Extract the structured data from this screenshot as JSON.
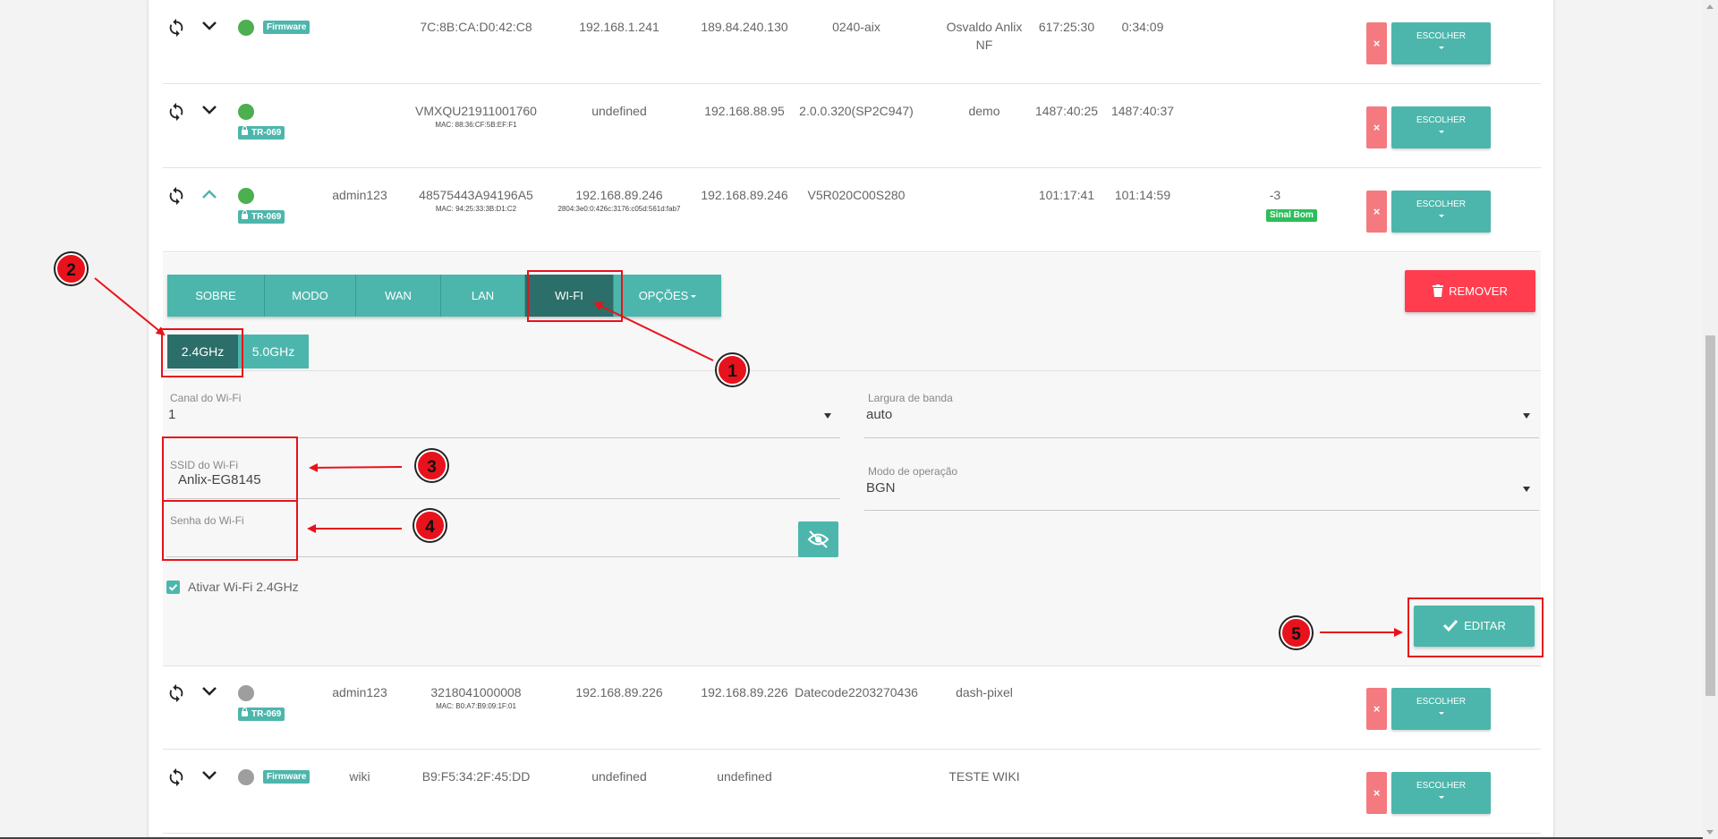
{
  "colors": {
    "teal": "#4db6ac",
    "teal_dark": "#2c6e69",
    "danger": "#ff3d4f",
    "delete_light": "#f47a7f",
    "status_online": "#4caf50",
    "status_offline": "#9e9e9e",
    "signal_good": "#2dbe5a",
    "annotation": "#e8121c"
  },
  "icons": {
    "sync": "sync-icon",
    "expand": "chevron-down-icon",
    "collapse": "chevron-up-icon",
    "lock": "lock-icon",
    "trash": "trash-icon",
    "eye_off": "eye-off-icon",
    "check": "check-icon"
  },
  "rows_top": [
    {
      "status": "online",
      "badge": "Firmware",
      "user": "",
      "serial": "7C:8B:CA:D0:42:C8",
      "mac": "",
      "ip_local": "192.168.1.241",
      "ip_public": "189.84.240.130",
      "version": "0240-aix",
      "name": "Osvaldo Anlix NF",
      "uptime": "617:25:30",
      "conn_time": "0:34:09",
      "signal": "",
      "signal_label": "",
      "delete_label": "×",
      "choose_label": "ESCOLHER"
    },
    {
      "status": "online",
      "badge": "TR-069",
      "user": "",
      "serial": "VMXQU21911001760",
      "mac": "MAC: 88:36:CF:5B:EF:F1",
      "ip_local": "undefined",
      "ip_public": "192.168.88.95",
      "version": "2.0.0.320(SP2C947)",
      "name": "demo",
      "uptime": "1487:40:25",
      "conn_time": "1487:40:37",
      "signal": "",
      "signal_label": "",
      "delete_label": "×",
      "choose_label": "ESCOLHER"
    },
    {
      "status": "online",
      "badge": "TR-069",
      "user": "admin123",
      "serial": "48575443A94196A5",
      "mac": "MAC: 94:25:33:3B:D1:C2",
      "ip_local": "192.168.89.246",
      "ip_local_sub": "2804:3e0:0:426c:3176:c05d:561d:fab7",
      "ip_public": "192.168.89.246",
      "version": "V5R020C00S280",
      "name": "",
      "uptime": "101:17:41",
      "conn_time": "101:14:59",
      "signal": "-3",
      "signal_label": "Sinal Bom",
      "delete_label": "×",
      "choose_label": "ESCOLHER"
    }
  ],
  "rows_bottom": [
    {
      "status": "offline",
      "badge": "TR-069",
      "user": "admin123",
      "serial": "3218041000008",
      "mac": "MAC: B0:A7:B9:09:1F:01",
      "ip_local": "192.168.89.226",
      "ip_public": "192.168.89.226",
      "version": "Datecode2203270436",
      "name": "dash-pixel",
      "uptime": "",
      "conn_time": "",
      "delete_label": "×",
      "choose_label": "ESCOLHER"
    },
    {
      "status": "offline",
      "badge": "Firmware",
      "user": "wiki",
      "serial": "B9:F5:34:2F:45:DD",
      "mac": "",
      "ip_local": "undefined",
      "ip_public": "undefined",
      "version": "",
      "name": "TESTE WIKI",
      "uptime": "",
      "conn_time": "",
      "delete_label": "×",
      "choose_label": "ESCOLHER"
    }
  ],
  "panel": {
    "tabs": [
      "SOBRE",
      "MODO",
      "WAN",
      "LAN",
      "WI-FI",
      "OPÇÕES"
    ],
    "active_tab": "WI-FI",
    "remove_label": "REMOVER",
    "freq_tabs": [
      "2.4GHz",
      "5.0GHz"
    ],
    "active_freq": "2.4GHz",
    "channel": {
      "label": "Canal do Wi-Fi",
      "value": "1"
    },
    "bandwidth": {
      "label": "Largura de banda",
      "value": "auto"
    },
    "ssid": {
      "label": "SSID do Wi-Fi",
      "value": "Anlix-EG8145"
    },
    "mode": {
      "label": "Modo de operação",
      "value": "BGN"
    },
    "password": {
      "label": "Senha do Wi-Fi",
      "value": ""
    },
    "enable_wifi": {
      "label": "Ativar Wi-Fi 2.4GHz",
      "checked": true
    },
    "edit_label": "EDITAR"
  },
  "annotations": [
    "1",
    "2",
    "3",
    "4",
    "5"
  ]
}
